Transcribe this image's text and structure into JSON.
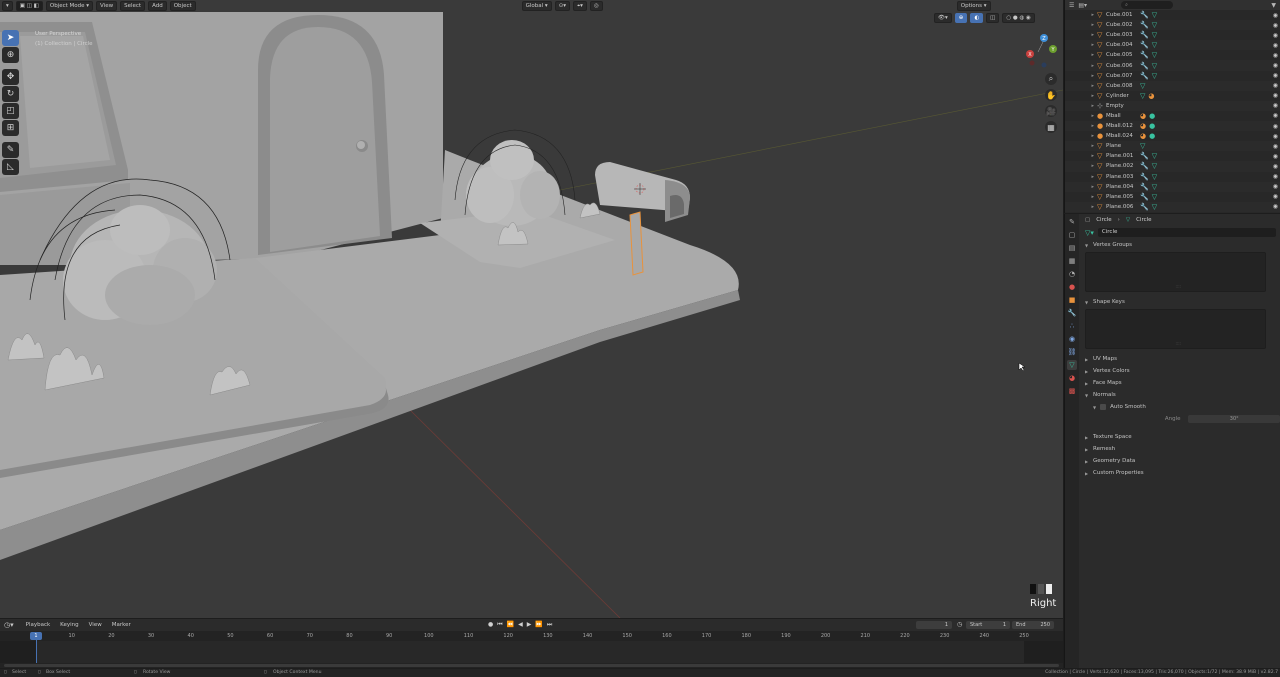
{
  "viewport": {
    "header": {
      "mode": "Object Mode",
      "menus": [
        "View",
        "Select",
        "Add",
        "Object"
      ],
      "transform_orientation": "Global",
      "options_label": "Options"
    },
    "info_line1": "User Perspective",
    "info_line2": "(1) Collection | Circle",
    "view_label": "Right",
    "tools": [
      "select-box",
      "cursor",
      "move",
      "rotate",
      "scale",
      "transform",
      "annotate",
      "measure"
    ],
    "colors": {
      "background": "#3a3a3a",
      "model": "#a6a6a6",
      "active_tool": "#4772b3",
      "selection": "#e8923c"
    }
  },
  "outliner": {
    "items": [
      {
        "name": "Cube.001",
        "icon": "mesh",
        "extras": [
          "modifier",
          "mesh-data"
        ]
      },
      {
        "name": "Cube.002",
        "icon": "mesh",
        "extras": [
          "modifier",
          "mesh-data"
        ]
      },
      {
        "name": "Cube.003",
        "icon": "mesh",
        "extras": [
          "modifier",
          "mesh-data"
        ]
      },
      {
        "name": "Cube.004",
        "icon": "mesh",
        "extras": [
          "modifier",
          "mesh-data"
        ]
      },
      {
        "name": "Cube.005",
        "icon": "mesh",
        "extras": [
          "modifier",
          "mesh-data"
        ]
      },
      {
        "name": "Cube.006",
        "icon": "mesh",
        "extras": [
          "modifier",
          "mesh-data"
        ]
      },
      {
        "name": "Cube.007",
        "icon": "mesh",
        "extras": [
          "modifier",
          "mesh-data"
        ]
      },
      {
        "name": "Cube.008",
        "icon": "mesh",
        "extras": [
          "mesh-data"
        ]
      },
      {
        "name": "Cylinder",
        "icon": "mesh",
        "extras": [
          "mesh-data",
          "material"
        ]
      },
      {
        "name": "Empty",
        "icon": "empty",
        "extras": []
      },
      {
        "name": "Mball",
        "icon": "metaball",
        "extras": [
          "material",
          "metaball-data"
        ]
      },
      {
        "name": "Mball.012",
        "icon": "metaball",
        "extras": [
          "material",
          "metaball-data"
        ]
      },
      {
        "name": "Mball.024",
        "icon": "metaball",
        "extras": [
          "material",
          "metaball-data"
        ]
      },
      {
        "name": "Plane",
        "icon": "mesh",
        "extras": [
          "mesh-data"
        ]
      },
      {
        "name": "Plane.001",
        "icon": "mesh",
        "extras": [
          "modifier",
          "mesh-data"
        ]
      },
      {
        "name": "Plane.002",
        "icon": "mesh",
        "extras": [
          "modifier",
          "mesh-data"
        ]
      },
      {
        "name": "Plane.003",
        "icon": "mesh",
        "extras": [
          "modifier",
          "mesh-data"
        ]
      },
      {
        "name": "Plane.004",
        "icon": "mesh",
        "extras": [
          "modifier",
          "mesh-data"
        ]
      },
      {
        "name": "Plane.005",
        "icon": "mesh",
        "extras": [
          "modifier",
          "mesh-data"
        ]
      },
      {
        "name": "Plane.006",
        "icon": "mesh",
        "extras": [
          "modifier",
          "mesh-data"
        ]
      }
    ]
  },
  "properties": {
    "breadcrumb_object": "Circle",
    "breadcrumb_data": "Circle",
    "mesh_name": "Circle",
    "panels": {
      "vertex_groups": "Vertex Groups",
      "shape_keys": "Shape Keys",
      "uv_maps": "UV Maps",
      "vertex_colors": "Vertex Colors",
      "face_maps": "Face Maps",
      "normals": "Normals",
      "auto_smooth": "Auto Smooth",
      "angle_label": "Angle",
      "angle_value": "30°",
      "texture_space": "Texture Space",
      "remesh": "Remesh",
      "geometry_data": "Geometry Data",
      "custom_properties": "Custom Properties"
    }
  },
  "timeline": {
    "menus": [
      "Playback",
      "Keying",
      "View",
      "Marker"
    ],
    "current_frame": "1",
    "start_label": "Start",
    "start": "1",
    "end_label": "End",
    "end": "250",
    "ticks": [
      "10",
      "20",
      "30",
      "40",
      "50",
      "60",
      "70",
      "80",
      "90",
      "100",
      "110",
      "120",
      "130",
      "140",
      "150",
      "160",
      "170",
      "180",
      "190",
      "200",
      "210",
      "220",
      "230",
      "240",
      "250"
    ],
    "playhead_label": "1"
  },
  "statusbar": {
    "select": "Select",
    "box_select": "Box Select",
    "rotate_view": "Rotate View",
    "context_menu": "Object Context Menu",
    "stats": "Collection | Circle | Verts:12,620 | Faces:13,095 | Tris:26,070 | Objects:1/72 | Mem: 38.9 MiB | v2.82.7"
  }
}
